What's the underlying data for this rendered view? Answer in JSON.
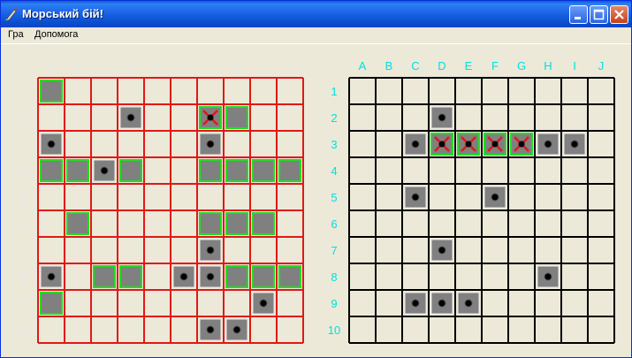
{
  "window": {
    "title": "Морський бій!"
  },
  "menu": [
    {
      "label": "Гра"
    },
    {
      "label": "Допомога"
    }
  ],
  "columns": [
    "A",
    "B",
    "C",
    "D",
    "E",
    "F",
    "G",
    "H",
    "I",
    "J"
  ],
  "rows": [
    "1",
    "2",
    "3",
    "4",
    "5",
    "6",
    "7",
    "8",
    "9",
    "10"
  ],
  "colors": {
    "player_grid": "#e01818",
    "enemy_grid": "#000000",
    "player_labels": "#e8e8e8",
    "enemy_labels": "#00e0e0",
    "ship_fill": "#808080",
    "ship_border": "#22dd22",
    "hit_cross": "#e01818",
    "miss_dot": "#000000",
    "cell_bg": "#ece9d8"
  },
  "player_board": {
    "cells": [
      {
        "col": "A",
        "row": "1",
        "state": "ship"
      },
      {
        "col": "D",
        "row": "2",
        "state": "miss"
      },
      {
        "col": "G",
        "row": "2",
        "state": "hit"
      },
      {
        "col": "H",
        "row": "2",
        "state": "ship"
      },
      {
        "col": "A",
        "row": "3",
        "state": "miss"
      },
      {
        "col": "G",
        "row": "3",
        "state": "miss"
      },
      {
        "col": "A",
        "row": "4",
        "state": "ship"
      },
      {
        "col": "B",
        "row": "4",
        "state": "ship"
      },
      {
        "col": "C",
        "row": "4",
        "state": "miss"
      },
      {
        "col": "D",
        "row": "4",
        "state": "ship"
      },
      {
        "col": "G",
        "row": "4",
        "state": "ship"
      },
      {
        "col": "H",
        "row": "4",
        "state": "ship"
      },
      {
        "col": "I",
        "row": "4",
        "state": "ship"
      },
      {
        "col": "J",
        "row": "4",
        "state": "ship"
      },
      {
        "col": "B",
        "row": "6",
        "state": "ship"
      },
      {
        "col": "G",
        "row": "6",
        "state": "ship"
      },
      {
        "col": "H",
        "row": "6",
        "state": "ship"
      },
      {
        "col": "I",
        "row": "6",
        "state": "ship"
      },
      {
        "col": "G",
        "row": "7",
        "state": "miss"
      },
      {
        "col": "A",
        "row": "8",
        "state": "miss"
      },
      {
        "col": "C",
        "row": "8",
        "state": "ship"
      },
      {
        "col": "D",
        "row": "8",
        "state": "ship"
      },
      {
        "col": "F",
        "row": "8",
        "state": "miss"
      },
      {
        "col": "G",
        "row": "8",
        "state": "miss"
      },
      {
        "col": "H",
        "row": "8",
        "state": "ship"
      },
      {
        "col": "I",
        "row": "8",
        "state": "ship"
      },
      {
        "col": "J",
        "row": "8",
        "state": "ship"
      },
      {
        "col": "A",
        "row": "9",
        "state": "ship"
      },
      {
        "col": "I",
        "row": "9",
        "state": "miss"
      },
      {
        "col": "G",
        "row": "10",
        "state": "miss"
      },
      {
        "col": "H",
        "row": "10",
        "state": "miss"
      }
    ]
  },
  "enemy_board": {
    "cells": [
      {
        "col": "D",
        "row": "2",
        "state": "miss"
      },
      {
        "col": "C",
        "row": "3",
        "state": "miss"
      },
      {
        "col": "D",
        "row": "3",
        "state": "hit"
      },
      {
        "col": "E",
        "row": "3",
        "state": "hit"
      },
      {
        "col": "F",
        "row": "3",
        "state": "hit"
      },
      {
        "col": "G",
        "row": "3",
        "state": "hit"
      },
      {
        "col": "H",
        "row": "3",
        "state": "miss"
      },
      {
        "col": "I",
        "row": "3",
        "state": "miss"
      },
      {
        "col": "C",
        "row": "5",
        "state": "miss"
      },
      {
        "col": "F",
        "row": "5",
        "state": "miss"
      },
      {
        "col": "D",
        "row": "7",
        "state": "miss"
      },
      {
        "col": "H",
        "row": "8",
        "state": "miss"
      },
      {
        "col": "C",
        "row": "9",
        "state": "miss"
      },
      {
        "col": "D",
        "row": "9",
        "state": "miss"
      },
      {
        "col": "E",
        "row": "9",
        "state": "miss"
      }
    ]
  }
}
